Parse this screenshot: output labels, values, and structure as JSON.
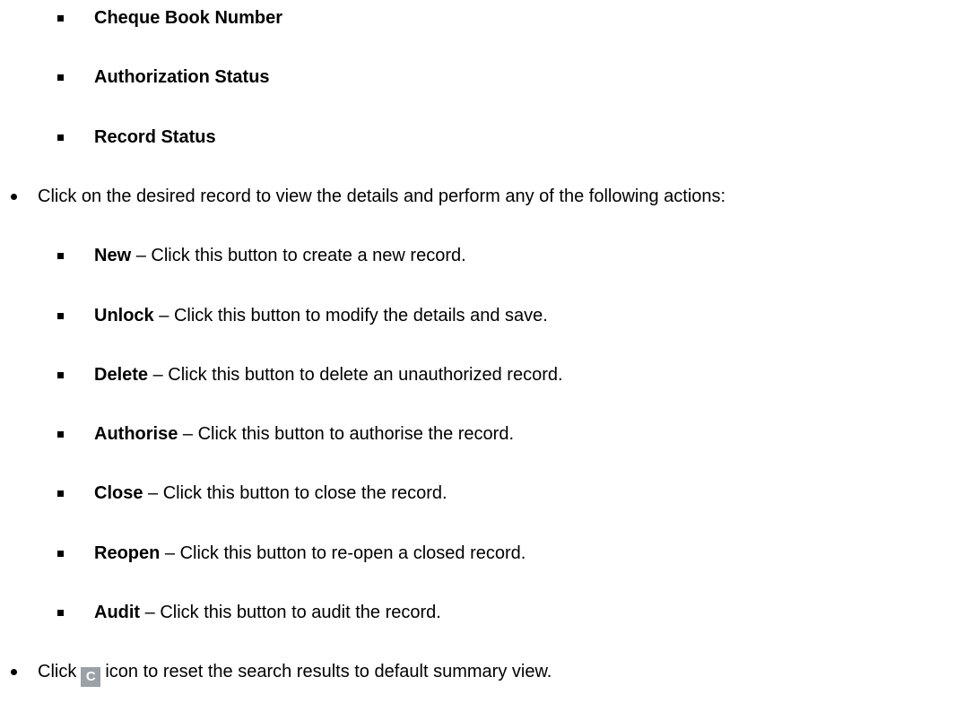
{
  "search_criteria_items": [
    {
      "label": "Cheque Book Number"
    },
    {
      "label": "Authorization Status"
    },
    {
      "label": "Record Status"
    }
  ],
  "record_instruction": "Click on the desired record to view the details and perform any of the following actions:",
  "actions": [
    {
      "name": "New",
      "description": "Click this button to create a new record."
    },
    {
      "name": "Unlock",
      "description": "Click this button to modify the details and save."
    },
    {
      "name": "Delete",
      "description": "Click this button to delete an unauthorized record."
    },
    {
      "name": "Authorise",
      "description": "Click this button to authorise the record."
    },
    {
      "name": "Close",
      "description": "Click this button to close the record."
    },
    {
      "name": "Reopen",
      "description": "Click this button to re-open a closed record."
    },
    {
      "name": "Audit",
      "description": "Click this button to audit the record."
    }
  ],
  "separator": "–",
  "reset_instruction": {
    "before": "Click",
    "icon_glyph": "C",
    "icon_name": "reset-icon",
    "after": "icon to reset the search results to default summary view."
  }
}
